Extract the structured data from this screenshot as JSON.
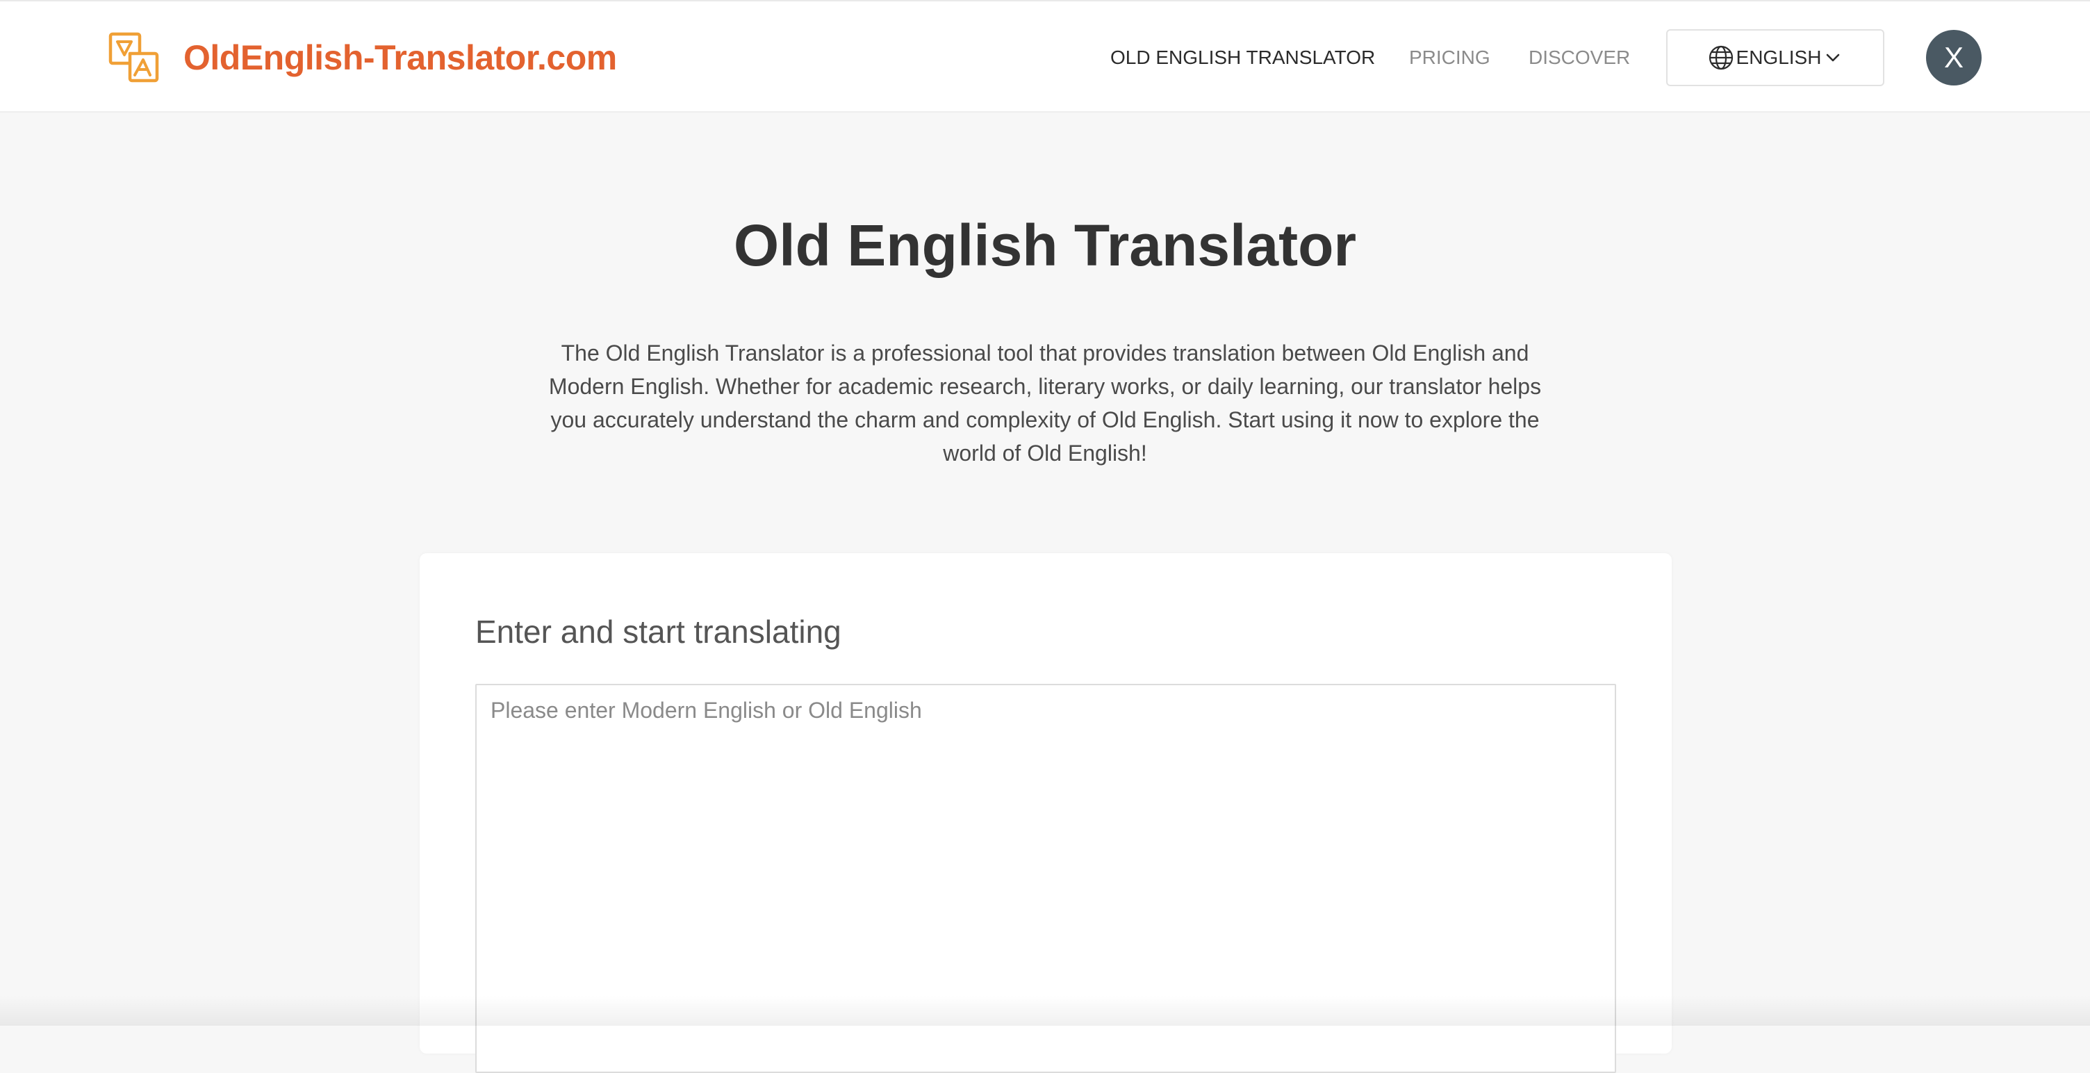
{
  "header": {
    "logo_text": "OldEnglish-Translator.com",
    "logo_icon": "translate-swap-icon",
    "nav": {
      "translator": "OLD ENGLISH TRANSLATOR",
      "pricing": "PRICING",
      "discover": "DISCOVER"
    },
    "language": {
      "label": "ENGLISH",
      "icon": "globe-icon",
      "chevron": "chevron-down-icon"
    },
    "avatar_initial": "X"
  },
  "main": {
    "title": "Old English Translator",
    "intro": "The Old English Translator is a professional tool that provides translation between Old English and Modern English. Whether for academic research, literary works, or daily learning, our translator helps you accurately understand the charm and complexity of Old English. Start using it now to explore the world of Old English!"
  },
  "translator": {
    "heading": "Enter and start translating",
    "input_value": "",
    "input_placeholder": "Please enter Modern English or Old English"
  },
  "colors": {
    "brand": "#e3622f",
    "logo_icon": "#f0a036",
    "avatar_bg": "#4a5963",
    "page_bg": "#f7f7f7"
  }
}
